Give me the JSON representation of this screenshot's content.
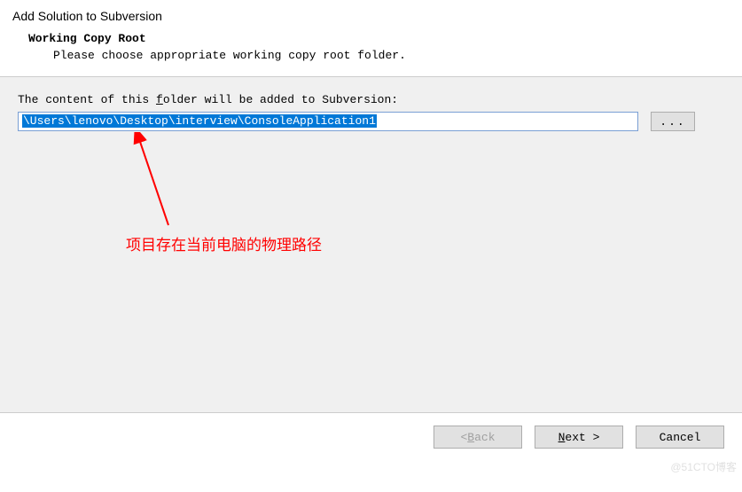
{
  "dialog": {
    "title": "Add Solution to Subversion",
    "sub_title": "Working Copy Root",
    "sub_desc": "Please choose appropriate working copy root folder."
  },
  "content": {
    "label_pre": "The content of this ",
    "label_underline": "f",
    "label_post": "older will be added to Subversion:",
    "path_value": "\\Users\\lenovo\\Desktop\\interview\\ConsoleApplication1",
    "browse_label": "..."
  },
  "annotation": {
    "text": "项目存在当前电脑的物理路径"
  },
  "footer": {
    "back_pre": "< ",
    "back_u": "B",
    "back_post": "ack",
    "next_u": "N",
    "next_post": "ext >",
    "cancel": "Cancel"
  },
  "watermark": "@51CTO博客"
}
